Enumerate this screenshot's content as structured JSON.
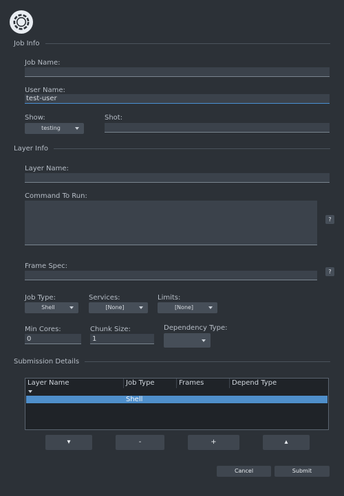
{
  "sections": {
    "job_info": "Job Info",
    "layer_info": "Layer Info",
    "submission_details": "Submission Details"
  },
  "job_info": {
    "job_name_label": "Job Name:",
    "job_name_value": "",
    "user_name_label": "User Name:",
    "user_name_value": "test-user",
    "show_label": "Show:",
    "show_value": "testing",
    "shot_label": "Shot:",
    "shot_value": ""
  },
  "layer_info": {
    "layer_name_label": "Layer Name:",
    "layer_name_value": "",
    "command_label": "Command To Run:",
    "command_value": "",
    "frame_spec_label": "Frame Spec:",
    "frame_spec_value": "",
    "help_label": "?",
    "job_type_label": "Job Type:",
    "job_type_value": "Shell",
    "services_label": "Services:",
    "services_value": "[None]",
    "limits_label": "Limits:",
    "limits_value": "[None]",
    "min_cores_label": "Min Cores:",
    "min_cores_value": "0",
    "chunk_size_label": "Chunk Size:",
    "chunk_size_value": "1",
    "dependency_type_label": "Dependency Type:",
    "dependency_type_value": ""
  },
  "table": {
    "columns": [
      "Layer Name",
      "Job Type",
      "Frames",
      "Depend Type"
    ],
    "rows": [
      {
        "layer_name": "",
        "job_type": "Shell",
        "frames": "",
        "depend_type": ""
      }
    ]
  },
  "controls": {
    "move_down": "▾",
    "remove": "-",
    "add": "+",
    "move_up": "▴"
  },
  "footer": {
    "cancel": "Cancel",
    "submit": "Submit"
  },
  "colors": {
    "background": "#2c3137",
    "field": "#3b424b",
    "accent": "#4a8fd3",
    "selection": "#4f8fcb"
  },
  "icons": {
    "logo": "cue-logo-icon",
    "dropdown": "chevron-down-icon",
    "help": "help-icon"
  }
}
